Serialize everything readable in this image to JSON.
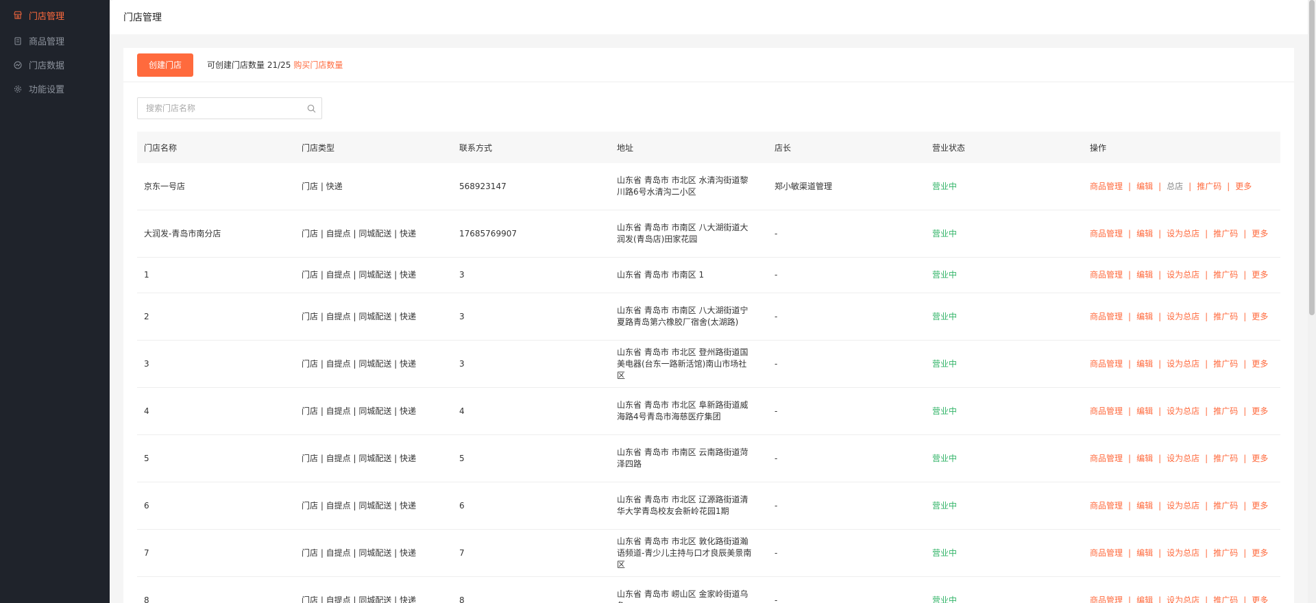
{
  "sidebar": {
    "items": [
      {
        "label": "门店管理",
        "icon": "store-icon",
        "active": true
      },
      {
        "label": "商品管理",
        "icon": "document-icon",
        "active": false
      },
      {
        "label": "门店数据",
        "icon": "data-icon",
        "active": false
      },
      {
        "label": "功能设置",
        "icon": "gear-icon",
        "active": false
      }
    ]
  },
  "header": {
    "title": "门店管理"
  },
  "toolbar": {
    "create_label": "创建门店",
    "quota_text": "可创建门店数量 21/25",
    "buy_label": "购买门店数量"
  },
  "search": {
    "placeholder": "搜索门店名称",
    "value": ""
  },
  "table": {
    "columns": [
      "门店名称",
      "门店类型",
      "联系方式",
      "地址",
      "店长",
      "营业状态",
      "操作"
    ],
    "rows": [
      {
        "name": "京东一号店",
        "type": "门店 | 快递",
        "contact": "568923147",
        "address": "山东省 青岛市 市北区 水清沟街道黎川路6号水清沟二小区",
        "manager": "郑小敏渠道管理",
        "status": "营业中",
        "ops": [
          "商品管理",
          "编辑",
          "总店",
          "推广码",
          "更多"
        ]
      },
      {
        "name": "大润发-青岛市南分店",
        "type": "门店 | 自提点 | 同城配送 | 快递",
        "contact": "17685769907",
        "address": "山东省 青岛市 市南区 八大湖街道大润发(青岛店)田家花园",
        "manager": "-",
        "status": "营业中",
        "ops": [
          "商品管理",
          "编辑",
          "设为总店",
          "推广码",
          "更多"
        ]
      },
      {
        "name": "1",
        "type": "门店 | 自提点 | 同城配送 | 快递",
        "contact": "3",
        "address": "山东省 青岛市 市南区 1",
        "manager": "-",
        "status": "营业中",
        "ops": [
          "商品管理",
          "编辑",
          "设为总店",
          "推广码",
          "更多"
        ]
      },
      {
        "name": "2",
        "type": "门店 | 自提点 | 同城配送 | 快递",
        "contact": "3",
        "address": "山东省 青岛市 市南区 八大湖街道宁夏路青岛第六橡胶厂宿舍(太湖路)",
        "manager": "-",
        "status": "营业中",
        "ops": [
          "商品管理",
          "编辑",
          "设为总店",
          "推广码",
          "更多"
        ]
      },
      {
        "name": "3",
        "type": "门店 | 自提点 | 同城配送 | 快递",
        "contact": "3",
        "address": "山东省 青岛市 市北区 登州路街道国美电器(台东一路新活馆)南山市场社区",
        "manager": "-",
        "status": "营业中",
        "ops": [
          "商品管理",
          "编辑",
          "设为总店",
          "推广码",
          "更多"
        ]
      },
      {
        "name": "4",
        "type": "门店 | 自提点 | 同城配送 | 快递",
        "contact": "4",
        "address": "山东省 青岛市 市北区 阜新路街道威海路4号青岛市海慈医疗集团",
        "manager": "-",
        "status": "营业中",
        "ops": [
          "商品管理",
          "编辑",
          "设为总店",
          "推广码",
          "更多"
        ]
      },
      {
        "name": "5",
        "type": "门店 | 自提点 | 同城配送 | 快递",
        "contact": "5",
        "address": "山东省 青岛市 市南区 云南路街道菏泽四路",
        "manager": "-",
        "status": "营业中",
        "ops": [
          "商品管理",
          "编辑",
          "设为总店",
          "推广码",
          "更多"
        ]
      },
      {
        "name": "6",
        "type": "门店 | 自提点 | 同城配送 | 快递",
        "contact": "6",
        "address": "山东省 青岛市 市北区 辽源路街道清华大学青岛校友会新岭花园1期",
        "manager": "-",
        "status": "营业中",
        "ops": [
          "商品管理",
          "编辑",
          "设为总店",
          "推广码",
          "更多"
        ]
      },
      {
        "name": "7",
        "type": "门店 | 自提点 | 同城配送 | 快递",
        "contact": "7",
        "address": "山东省 青岛市 市北区 敦化路街道瀚语频道-青少儿主持与口才良辰美景南区",
        "manager": "-",
        "status": "营业中",
        "ops": [
          "商品管理",
          "编辑",
          "设为总店",
          "推广码",
          "更多"
        ]
      },
      {
        "name": "8",
        "type": "门店 | 自提点 | 同城配送 | 快递",
        "contact": "8",
        "address": "山东省 青岛市 崂山区 金家岭街道乌龟",
        "manager": "-",
        "status": "营业中",
        "ops": [
          "商品管理",
          "编辑",
          "设为总店",
          "推广码",
          "更多"
        ]
      }
    ]
  },
  "colors": {
    "accent": "#ff6a3d",
    "sidebar_bg": "#1f232b",
    "status_green": "#2fb366"
  }
}
